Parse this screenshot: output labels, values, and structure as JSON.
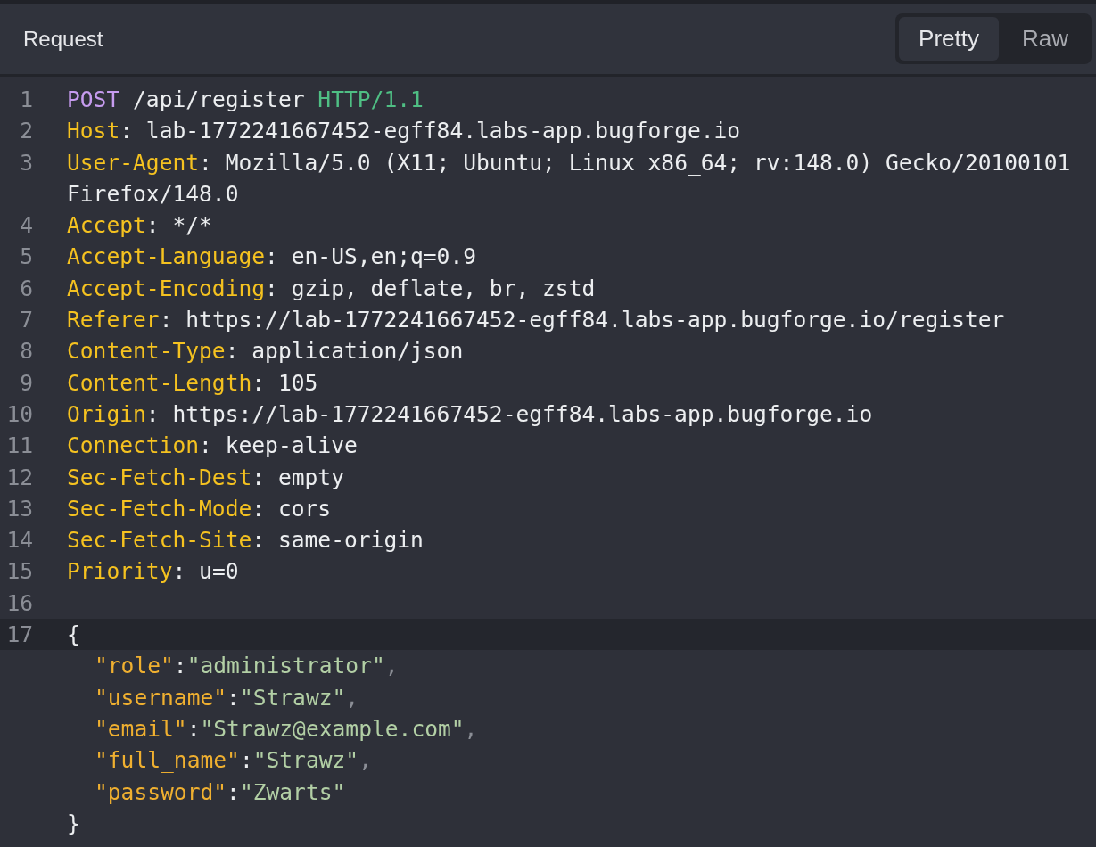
{
  "panel": {
    "title": "Request"
  },
  "tabs": [
    {
      "label": "Pretty",
      "selected": true
    },
    {
      "label": "Raw",
      "selected": false
    }
  ],
  "lines": [
    {
      "number": "1",
      "kind": "request",
      "current": false,
      "method": "POST",
      "path": " /api/register ",
      "version": "HTTP/1.1"
    },
    {
      "number": "2",
      "kind": "header",
      "current": false,
      "name": "Host",
      "sep": ": ",
      "value": "lab-1772241667452-egff84.labs-app.bugforge.io"
    },
    {
      "number": "3",
      "kind": "header",
      "current": false,
      "name": "User-Agent",
      "sep": ": ",
      "value": "Mozilla/5.0 (X11; Ubuntu; Linux x86_64; rv:148.0) Gecko/20100101 Firefox/148.0"
    },
    {
      "number": "4",
      "kind": "header",
      "current": false,
      "name": "Accept",
      "sep": ": ",
      "value": "*/*"
    },
    {
      "number": "5",
      "kind": "header",
      "current": false,
      "name": "Accept-Language",
      "sep": ": ",
      "value": "en-US,en;q=0.9"
    },
    {
      "number": "6",
      "kind": "header",
      "current": false,
      "name": "Accept-Encoding",
      "sep": ": ",
      "value": "gzip, deflate, br, zstd"
    },
    {
      "number": "7",
      "kind": "header",
      "current": false,
      "name": "Referer",
      "sep": ": ",
      "value": "https://lab-1772241667452-egff84.labs-app.bugforge.io/register"
    },
    {
      "number": "8",
      "kind": "header",
      "current": false,
      "name": "Content-Type",
      "sep": ": ",
      "value": "application/json"
    },
    {
      "number": "9",
      "kind": "header",
      "current": false,
      "name": "Content-Length",
      "sep": ": ",
      "value": "105"
    },
    {
      "number": "10",
      "kind": "header",
      "current": false,
      "name": "Origin",
      "sep": ": ",
      "value": "https://lab-1772241667452-egff84.labs-app.bugforge.io"
    },
    {
      "number": "11",
      "kind": "header",
      "current": false,
      "name": "Connection",
      "sep": ": ",
      "value": "keep-alive"
    },
    {
      "number": "12",
      "kind": "header",
      "current": false,
      "name": "Sec-Fetch-Dest",
      "sep": ": ",
      "value": "empty"
    },
    {
      "number": "13",
      "kind": "header",
      "current": false,
      "name": "Sec-Fetch-Mode",
      "sep": ": ",
      "value": "cors"
    },
    {
      "number": "14",
      "kind": "header",
      "current": false,
      "name": "Sec-Fetch-Site",
      "sep": ": ",
      "value": "same-origin"
    },
    {
      "number": "15",
      "kind": "header",
      "current": false,
      "name": "Priority",
      "sep": ": ",
      "value": "u=0"
    },
    {
      "number": "16",
      "kind": "blank",
      "current": false
    },
    {
      "number": "17",
      "kind": "body",
      "current": true,
      "open": "{",
      "close": "}",
      "fields": [
        {
          "key": "\"role\"",
          "sep": ":",
          "value": "\"administrator\"",
          "comma": ","
        },
        {
          "key": "\"username\"",
          "sep": ":",
          "value": "\"Strawz\"",
          "comma": ","
        },
        {
          "key": "\"email\"",
          "sep": ":",
          "value": "\"Strawz@example.com\"",
          "comma": ","
        },
        {
          "key": "\"full_name\"",
          "sep": ":",
          "value": "\"Strawz\"",
          "comma": ","
        },
        {
          "key": "\"password\"",
          "sep": ":",
          "value": "\"Zwarts\""
        }
      ]
    }
  ]
}
